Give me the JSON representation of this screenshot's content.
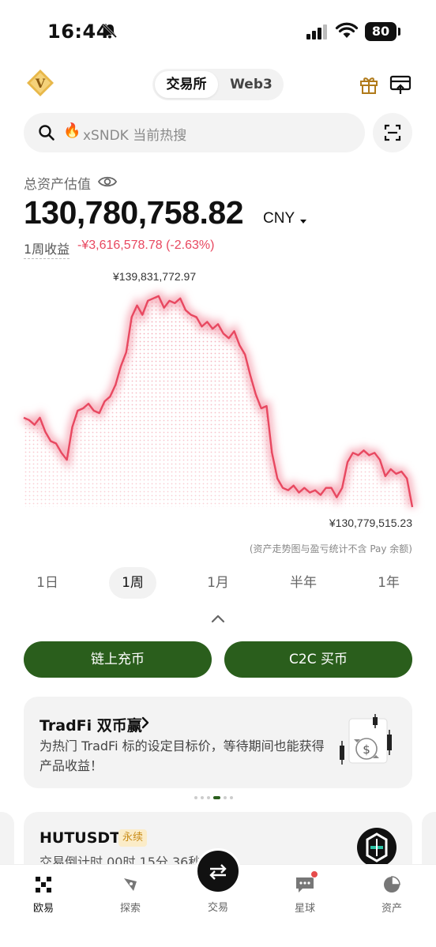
{
  "status_bar": {
    "time": "16:44",
    "battery": "80"
  },
  "header": {
    "tabs": [
      "交易所",
      "Web3"
    ],
    "active_tab": "交易所"
  },
  "search": {
    "placeholder": "xSNDK 当前热搜"
  },
  "assets": {
    "label": "总资产估值",
    "value": "130,780,758.82",
    "currency": "CNY",
    "pnl_label": "1周收益",
    "pnl_value": "-¥3,616,578.78 (-2.63%)",
    "chart_max_label": "¥139,831,772.97",
    "chart_min_label": "¥130,779,515.23",
    "chart_note": "(资产走势图与盈亏统计不含 Pay 余额)",
    "colors": {
      "line": "#e84860",
      "positive_action": "#2a5e1c"
    }
  },
  "chart_data": {
    "type": "line",
    "series": [
      {
        "values": [
          134.6,
          134.5,
          134.3,
          134.6,
          134.0,
          133.6,
          133.5,
          133.1,
          132.8,
          134.2,
          134.9,
          135.0,
          135.2,
          134.9,
          134.8,
          135.3,
          135.5,
          136.0,
          136.8,
          137.4,
          138.9,
          139.4,
          139.0,
          139.6,
          139.7,
          139.8,
          139.3,
          139.6,
          139.5,
          139.7,
          139.2,
          139.0,
          138.9,
          138.5,
          138.7,
          138.4,
          138.6,
          138.2,
          138.0,
          138.3,
          137.7,
          137.3,
          136.4,
          135.6,
          135.0,
          135.1,
          133.1,
          132.0,
          131.6,
          131.5,
          131.7,
          131.4,
          131.6,
          131.4,
          131.5,
          131.3,
          131.6,
          131.6,
          131.2,
          131.6,
          132.7,
          133.1,
          133.0,
          133.2,
          133.0,
          133.1,
          132.8,
          132.1,
          132.4,
          132.2,
          132.3,
          132.0,
          130.78
        ]
      }
    ],
    "ylabel_unit": "¥ millions",
    "ymax": 139.83,
    "ymin": 130.78
  },
  "ranges": [
    "1日",
    "1周",
    "1月",
    "半年",
    "1年"
  ],
  "active_range": "1周",
  "actions": {
    "onchain_deposit": "链上充币",
    "c2c_buy": "C2C 买币"
  },
  "banner": {
    "title": "TradFi 双币赢",
    "desc": "为热门 TradFi 标的设定目标价，等待期间也能获得产品收益！"
  },
  "feed": {
    "symbol": "HUTUSDT",
    "tag": "永续",
    "countdown": "交易倒计时 00时 15分 36秒"
  },
  "nav": {
    "home": "欧易",
    "explore": "探索",
    "trade": "交易",
    "planet": "星球",
    "assets": "资产"
  }
}
